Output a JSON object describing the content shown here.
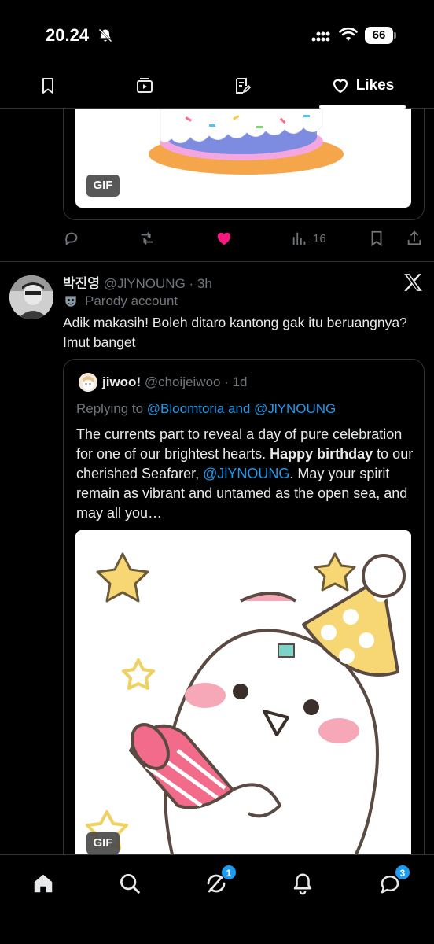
{
  "status_bar": {
    "time": "20.24",
    "battery": "66",
    "icons": [
      "bell-off-icon",
      "signal-icon",
      "wifi-icon",
      "battery-icon"
    ]
  },
  "tabs": [
    {
      "icon": "bookmark-icon",
      "label": ""
    },
    {
      "icon": "video-icon",
      "label": ""
    },
    {
      "icon": "article-icon",
      "label": ""
    },
    {
      "icon": "heart-icon",
      "label": "Likes",
      "active": true
    }
  ],
  "previous_tweet": {
    "media_badge": "GIF",
    "actions": {
      "reply_icon": "reply-icon",
      "retweet_icon": "retweet-icon",
      "like_icon": "heart-filled-icon",
      "views_icon": "views-icon",
      "views": "16",
      "bookmark_icon": "bookmark-icon",
      "share_icon": "share-icon"
    },
    "like_color": "#f91880"
  },
  "tweet": {
    "name": "박진영",
    "handle": "@JlYNOUNG",
    "time": "· 3h",
    "parody_label": "Parody account",
    "text": "Adik makasih! Boleh ditaro kantong gak itu beruangnya? Imut banget"
  },
  "quoted": {
    "name": "jiwoo!",
    "handle": "@choijeiwoo",
    "time": "· 1d",
    "replying_prefix": "Replying to ",
    "replying_to": "@Bloomtoria and @JlYNOUNG",
    "text_part1": "The currents part to reveal a day of pure celebration for one of our brightest hearts. ",
    "text_bold": "Happy birthday",
    "text_part2": " to our cherished Seafarer, ",
    "text_mention": "@JlYNOUNG",
    "text_part3": ". May your spirit remain as vibrant and untamed as the open sea, and may all you…",
    "media_badge": "GIF"
  },
  "bottom_nav": {
    "items": [
      "home-icon",
      "search-icon",
      "grok-icon",
      "notifications-icon",
      "messages-icon"
    ],
    "grok_badge": "1",
    "messages_badge": "3"
  },
  "colors": {
    "accent": "#1d9bf0",
    "like": "#f91880",
    "muted": "#71767b",
    "text": "#e7e9ea",
    "border": "#2f3336"
  }
}
